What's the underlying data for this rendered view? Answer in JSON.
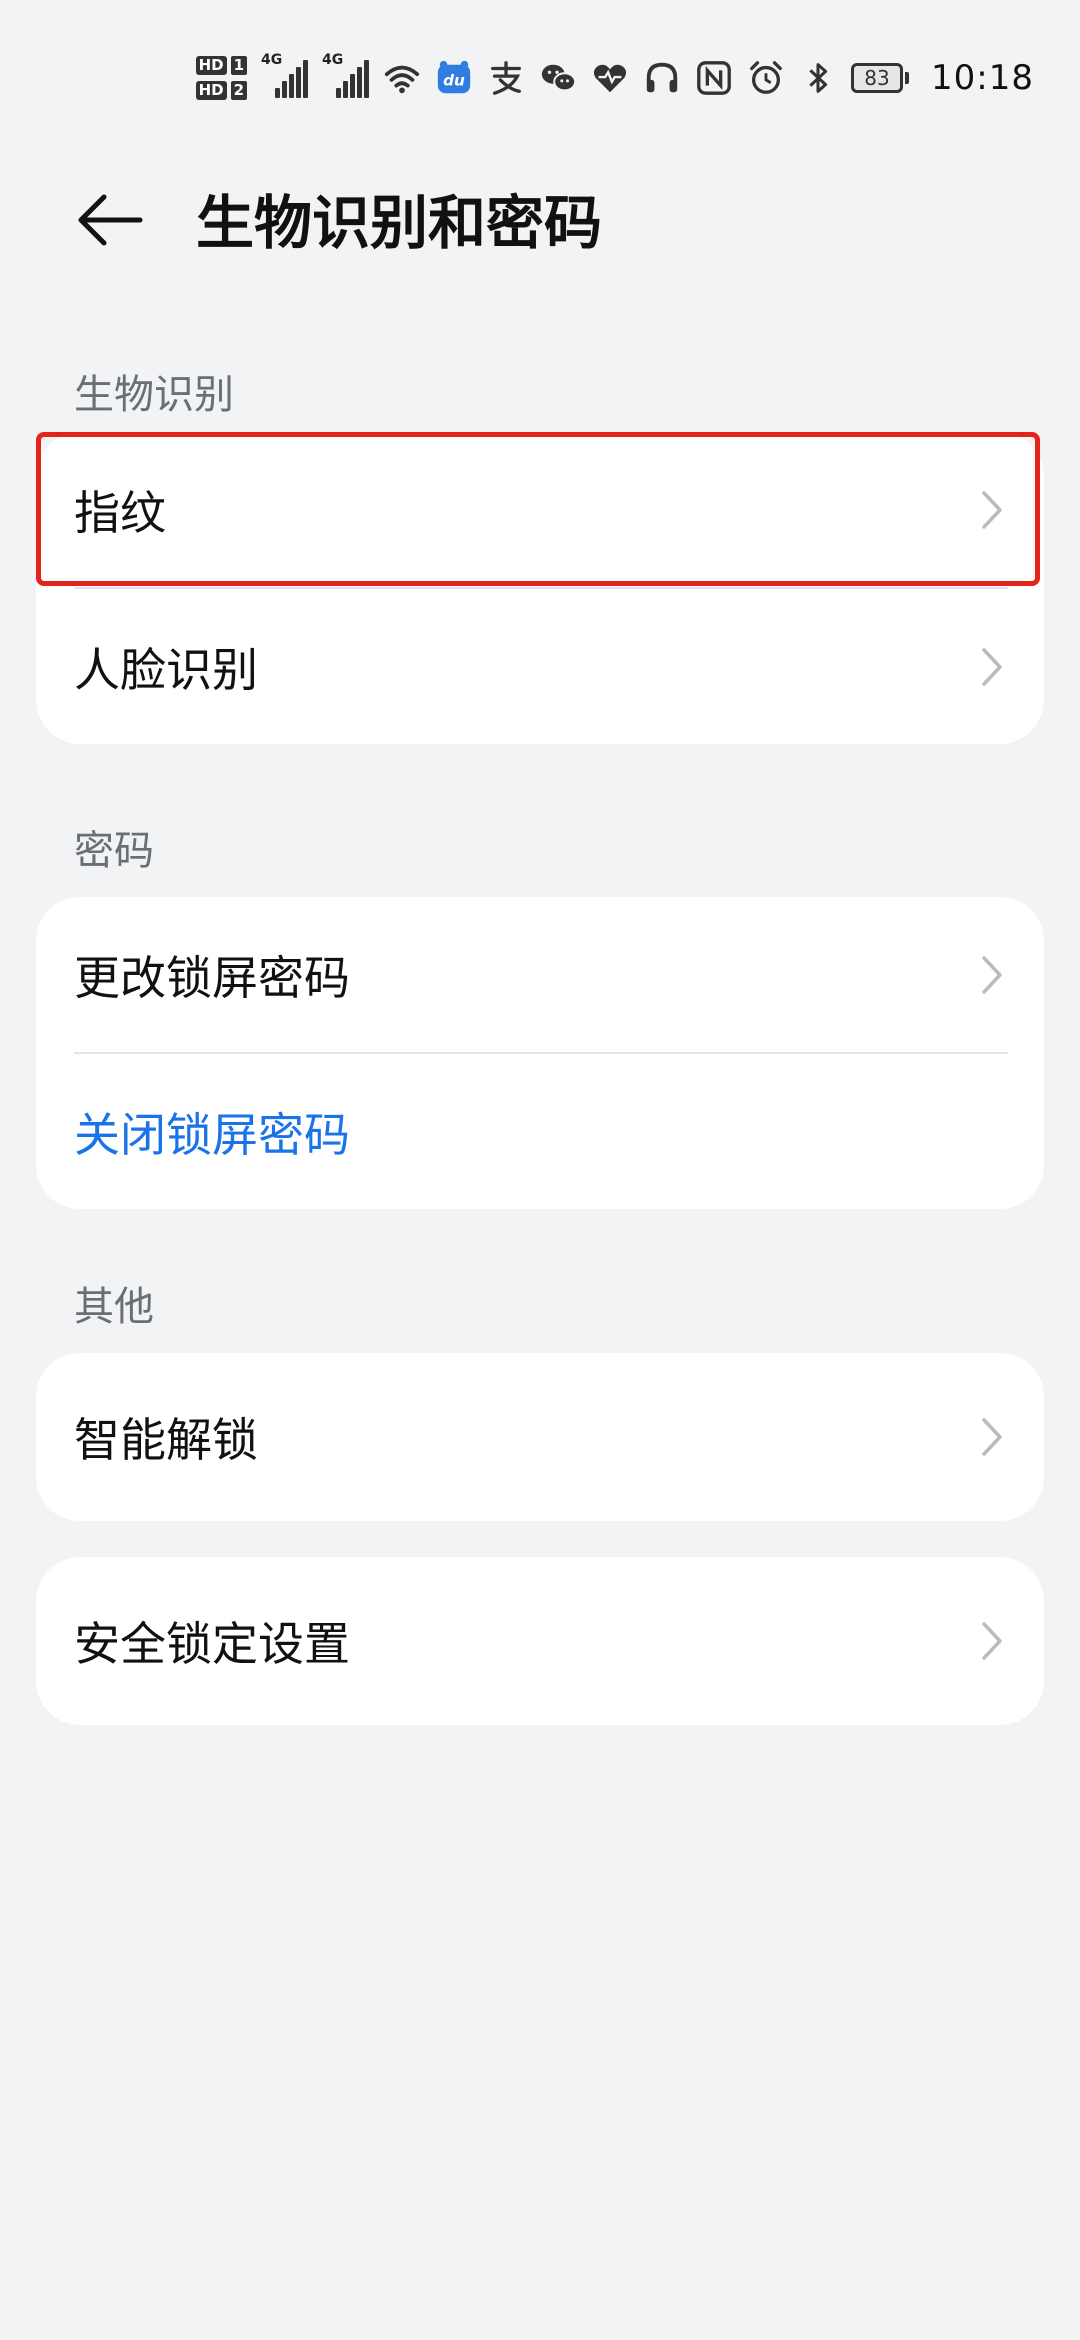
{
  "status_bar": {
    "sim1_label": "HD",
    "sim1_num": "1",
    "sim2_label": "HD",
    "sim2_num": "2",
    "network1": "4G",
    "network2": "4G",
    "app_badge": "du",
    "battery": "83",
    "time": "10:18",
    "icons": [
      "signal-icon",
      "wifi-icon",
      "baidu-icon",
      "alipay-icon",
      "wechat-icon",
      "health-icon",
      "headphones-icon",
      "nfc-icon",
      "alarm-icon",
      "bluetooth-icon",
      "battery-icon"
    ]
  },
  "header": {
    "back_icon": "arrow-left-icon",
    "title": "生物识别和密码"
  },
  "sections": {
    "biometrics": {
      "label": "生物识别",
      "items": [
        {
          "label": "指纹"
        },
        {
          "label": "人脸识别"
        }
      ]
    },
    "password": {
      "label": "密码",
      "items": [
        {
          "label": "更改锁屏密码"
        },
        {
          "label": "关闭锁屏密码"
        }
      ]
    },
    "other": {
      "label": "其他",
      "items": [
        {
          "label": "智能解锁"
        }
      ]
    },
    "security": {
      "items": [
        {
          "label": "安全锁定设置"
        }
      ]
    }
  },
  "colors": {
    "background": "#f1f3f5",
    "card": "#ffffff",
    "accent": "#1a73e8",
    "highlight": "#e3231c"
  }
}
